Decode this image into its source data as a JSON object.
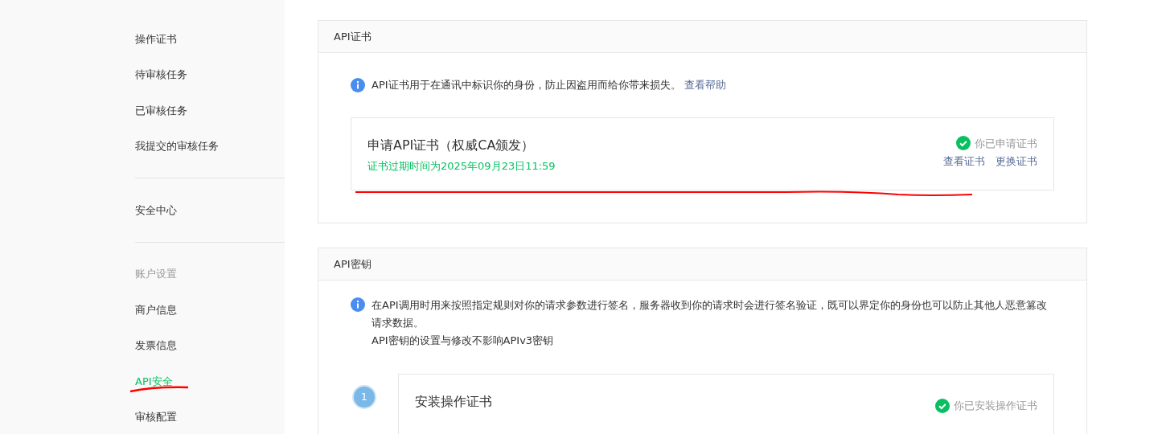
{
  "sidebar": {
    "items": [
      {
        "label": "操作证书",
        "kind": "item",
        "selected": false
      },
      {
        "label": "待审核任务",
        "kind": "item",
        "selected": false
      },
      {
        "label": "已审核任务",
        "kind": "item",
        "selected": false
      },
      {
        "label": "我提交的审核任务",
        "kind": "item",
        "selected": false
      },
      {
        "kind": "divider"
      },
      {
        "label": "安全中心",
        "kind": "item",
        "selected": false
      },
      {
        "kind": "divider"
      },
      {
        "label": "账户设置",
        "kind": "heading"
      },
      {
        "label": "商户信息",
        "kind": "item",
        "selected": false
      },
      {
        "label": "发票信息",
        "kind": "item",
        "selected": false
      },
      {
        "label": "API安全",
        "kind": "item",
        "selected": true
      },
      {
        "label": "审核配置",
        "kind": "item",
        "selected": false
      }
    ]
  },
  "cert_panel": {
    "title": "API证书",
    "notice": "API证书用于在通讯中标识你的身份，防止因盗用而给你带来损失。",
    "help_link": "查看帮助",
    "cert": {
      "title": "申请API证书（权威CA颁发）",
      "expiry": "证书过期时间为2025年09月23日11:59",
      "status": "你已申请证书",
      "done": true,
      "actions": [
        "查看证书",
        "更换证书"
      ]
    }
  },
  "key_panel": {
    "title": "API密钥",
    "notice": [
      "在API调用时用来按照指定规则对你的请求参数进行签名，服务器收到你的请求时会进行签名验证，既可以界定你的身份也可以防止其他人恶意篡改请求数据。",
      "API密钥的设置与修改不影响APIv3密钥"
    ],
    "steps": [
      {
        "number": "1",
        "title": "安装操作证书",
        "status": "你已安装操作证书",
        "done": true
      }
    ]
  }
}
